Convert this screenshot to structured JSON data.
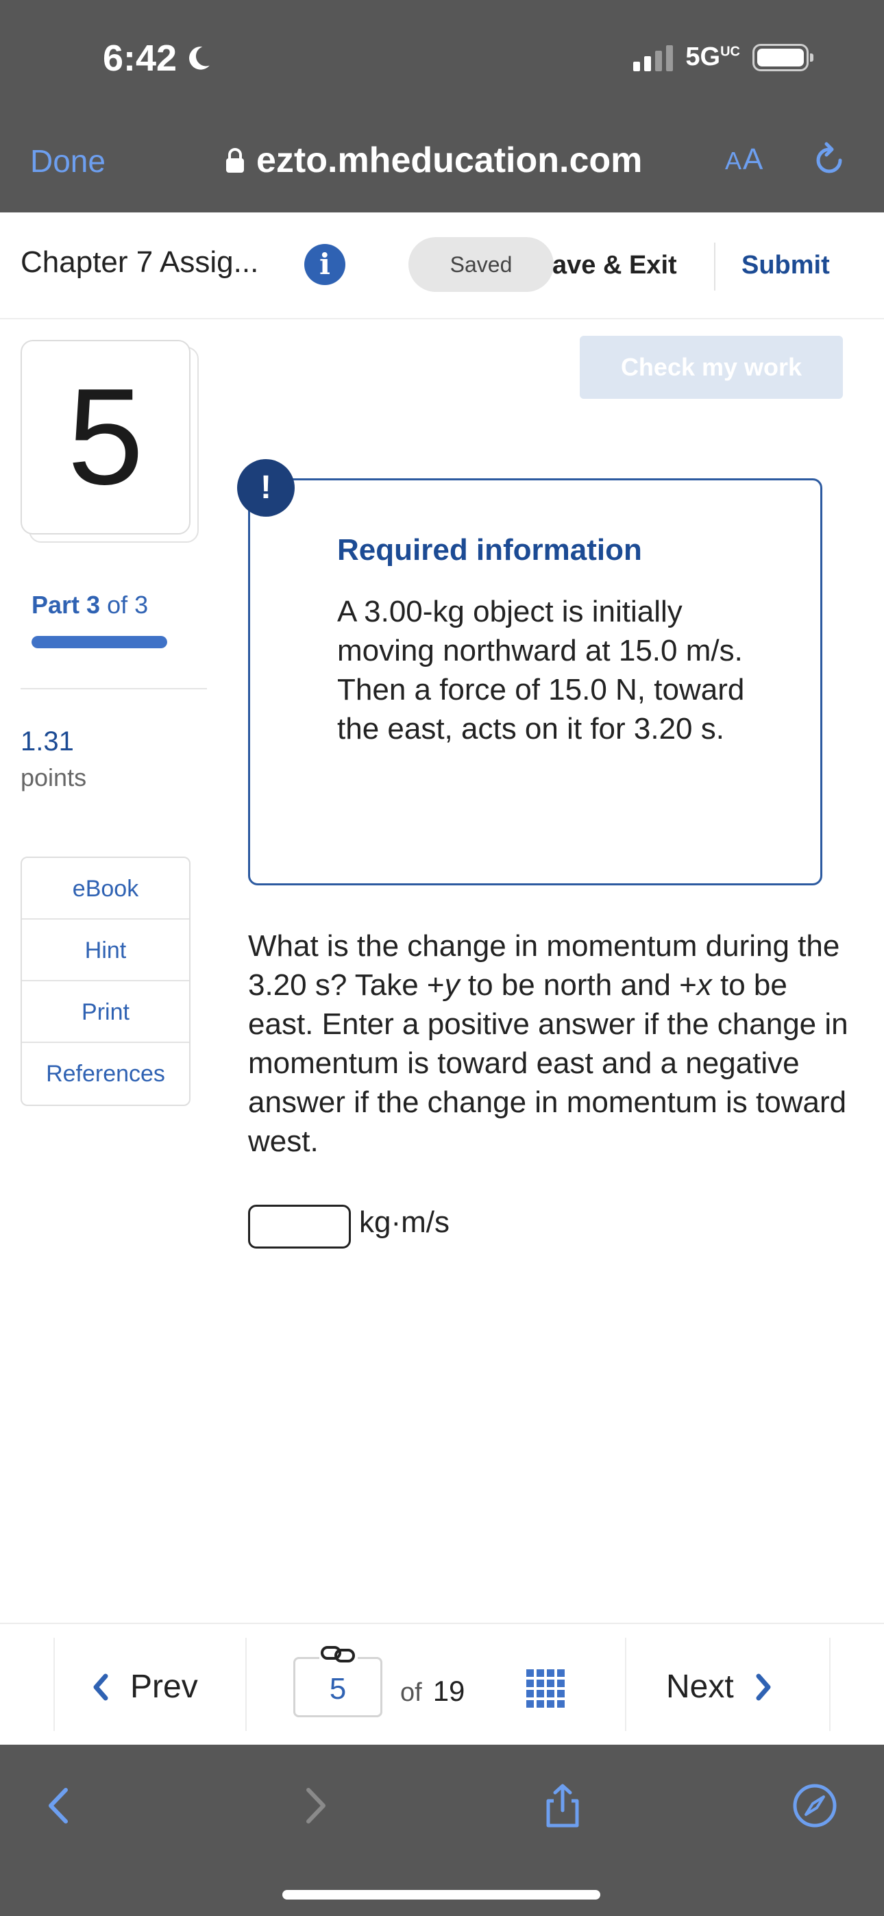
{
  "status_bar": {
    "time": "6:42",
    "network": "5G",
    "network_sup": "UC"
  },
  "browser": {
    "done_label": "Done",
    "url": "ezto.mheducation.com",
    "aa_label_small": "A",
    "aa_label_large": "A"
  },
  "assignment": {
    "title": "Chapter 7 Assig...",
    "saved_label": "Saved",
    "save_exit_label": "ave & Exit",
    "submit_label": "Submit"
  },
  "question_panel": {
    "number": "5",
    "part_word": "Part",
    "part_current": "3",
    "part_of_text": "of 3",
    "part_progress": 1.0,
    "points_value": "1.31",
    "points_label": "points",
    "tools": [
      "eBook",
      "Hint",
      "Print",
      "References"
    ]
  },
  "main": {
    "check_label": "Check my work",
    "required_title": "Required information",
    "required_text": "A 3.00-kg object is initially moving northward at 15.0 m/s. Then a force of 15.0 N, toward the east, acts on it for 3.20 s.",
    "question_parts": {
      "p1": "What is the change in momentum during the 3.20 s? Take +",
      "y": "y",
      "p2": " to be north and +",
      "x": "x",
      "p3": " to be east. Enter a positive answer if the change in momentum is toward east and a negative answer if the change in momentum is toward west."
    },
    "answer_value": "",
    "unit": "kg·m/s"
  },
  "nav": {
    "prev_label": "Prev",
    "next_label": "Next",
    "current_page": "5",
    "of_label": "of",
    "total_pages": "19"
  },
  "colors": {
    "brand_blue": "#2f62b3",
    "dark_blue": "#1c4b94",
    "safari_gray": "#575757"
  }
}
